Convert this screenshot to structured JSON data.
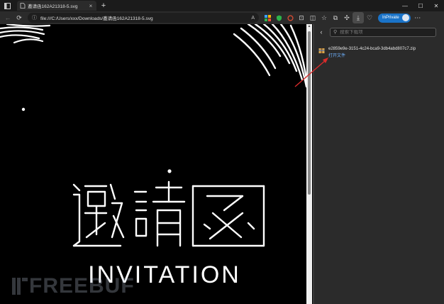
{
  "tab": {
    "title": "邀请函162A21318-5.svg",
    "close": "×",
    "new_tab": "+"
  },
  "window": {
    "minimize": "—",
    "maximize": "☐",
    "close": "✕"
  },
  "address_bar": {
    "url": "file:///C:/Users/xxx/Downloads/邀请函162A21318-5.svg"
  },
  "profile": {
    "label": "InPrivate"
  },
  "downloads_panel": {
    "search_placeholder": "搜索下载项",
    "items": [
      {
        "file_name": "e2859e9e-3151-4c24-bca9-3db4abd807c7.zip",
        "action": "打开文件"
      }
    ]
  },
  "page_content": {
    "heading_cn": "邀請函",
    "heading_en": "INVITATION"
  },
  "watermark": {
    "text": "FREEBUF"
  },
  "colors": {
    "accent": "#1a73c8",
    "link": "#6fb2ff",
    "annotation_arrow": "#d92b2b",
    "page_bg": "#000000"
  }
}
